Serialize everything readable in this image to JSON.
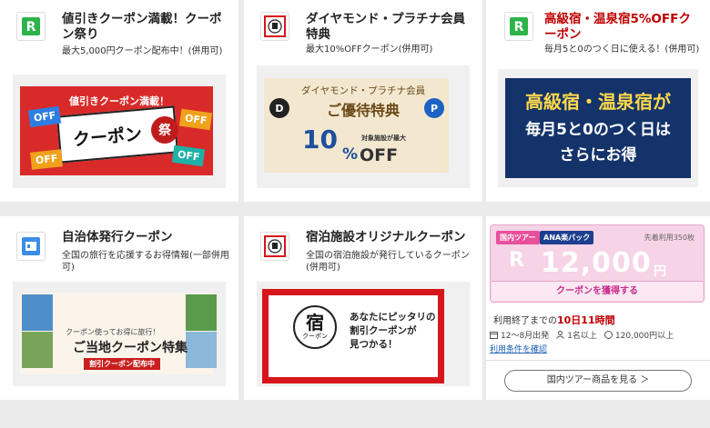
{
  "cards": [
    {
      "title": "値引きクーポン満載！クーポン祭り",
      "desc": "最大5,000円クーポン配布中！(併用可)",
      "logo": "rakuten-travel-logo"
    },
    {
      "title": "ダイヤモンド・プラチナ会員特典",
      "desc": "最大10%OFFクーポン(併用可)",
      "logo": "yado-stamp-logo"
    },
    {
      "title": "高級宿・温泉宿5%OFFクーポン",
      "desc": "毎月5と0のつく日に使える！(併用可)",
      "logo": "rakuten-travel-logo"
    },
    {
      "title": "自治体発行クーポン",
      "desc": "全国の旅行を応援するお得情報(一部併用可)",
      "logo": "municipal-coupon-logo"
    },
    {
      "title": "宿泊施設オリジナルクーポン",
      "desc": "全国の宿泊施設が発行しているクーポン(併用可)",
      "logo": "yado-stamp-logo"
    }
  ],
  "banner1": {
    "top": "値引きクーポン満載！",
    "main": "クーポン",
    "seal": "祭",
    "tags": [
      "OFF",
      "OFF",
      "OFF",
      "OFF"
    ]
  },
  "banner2": {
    "line1": "ダイヤモンド・プラチナ会員",
    "line2": "ご優待特典",
    "pct": "10",
    "pct_unit": "%",
    "off": "OFF",
    "sub": "対象施設が最大",
    "medal_d": "D",
    "medal_p": "P"
  },
  "banner3": {
    "line1": "高級宿・温泉宿が",
    "line2": "毎月5と0のつく日は",
    "line3": "さらにお得"
  },
  "banner4": {
    "line1": "クーポン使ってお得に旅行！",
    "line2": "ご当地クーポン特集",
    "btn": "割引クーポン配布中"
  },
  "banner5": {
    "stamp": "宿",
    "stamp_sub": "クーポン",
    "msg1": "あなたにピッタリの",
    "msg2": "割引クーポンが",
    "msg3": "見つかる！"
  },
  "coupon": {
    "badge1": "国内ツアー",
    "badge2": "ANA楽パック",
    "used": "先着利用350枚",
    "r": "R",
    "amount": "12,000",
    "unit": "円",
    "button": "クーポンを獲得する",
    "countdown_label": "利用終了までの",
    "countdown_value": "10日11時間",
    "period": "12～8月出発",
    "people": "1名以上",
    "min_price": "120,000円以上",
    "terms": "利用条件を確認",
    "more": "国内ツアー商品を見る ＞"
  }
}
